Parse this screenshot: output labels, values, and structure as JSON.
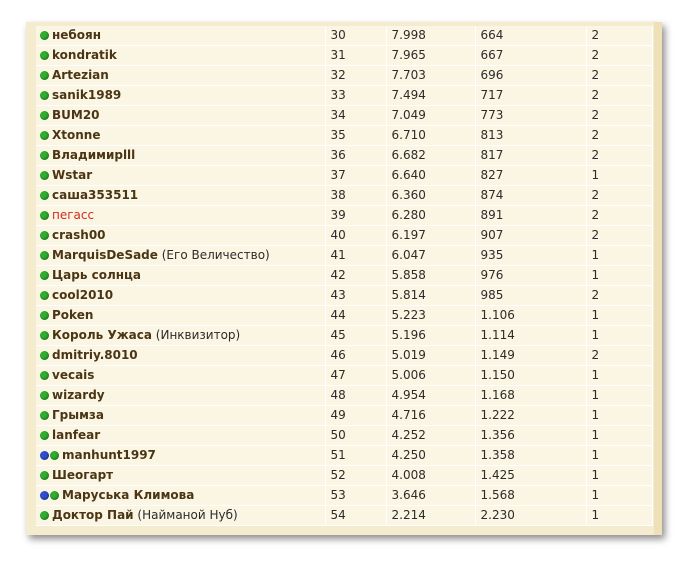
{
  "rows": [
    {
      "dots": [
        "green"
      ],
      "name": "небоян",
      "title": "",
      "red": false,
      "place": "30",
      "score": "7.998",
      "count": "664",
      "level": "2"
    },
    {
      "dots": [
        "green"
      ],
      "name": "kondratik",
      "title": "",
      "red": false,
      "place": "31",
      "score": "7.965",
      "count": "667",
      "level": "2"
    },
    {
      "dots": [
        "green"
      ],
      "name": "Artezian",
      "title": "",
      "red": false,
      "place": "32",
      "score": "7.703",
      "count": "696",
      "level": "2"
    },
    {
      "dots": [
        "green"
      ],
      "name": "sanik1989",
      "title": "",
      "red": false,
      "place": "33",
      "score": "7.494",
      "count": "717",
      "level": "2"
    },
    {
      "dots": [
        "green"
      ],
      "name": "BUM20",
      "title": "",
      "red": false,
      "place": "34",
      "score": "7.049",
      "count": "773",
      "level": "2"
    },
    {
      "dots": [
        "green"
      ],
      "name": "Xtonne",
      "title": "",
      "red": false,
      "place": "35",
      "score": "6.710",
      "count": "813",
      "level": "2"
    },
    {
      "dots": [
        "green"
      ],
      "name": "Владимирlll",
      "title": "",
      "red": false,
      "place": "36",
      "score": "6.682",
      "count": "817",
      "level": "2"
    },
    {
      "dots": [
        "green"
      ],
      "name": "Wstar",
      "title": "",
      "red": false,
      "place": "37",
      "score": "6.640",
      "count": "827",
      "level": "1"
    },
    {
      "dots": [
        "green"
      ],
      "name": "саша353511",
      "title": "",
      "red": false,
      "place": "38",
      "score": "6.360",
      "count": "874",
      "level": "2"
    },
    {
      "dots": [
        "green"
      ],
      "name": "пегасс",
      "title": "",
      "red": true,
      "place": "39",
      "score": "6.280",
      "count": "891",
      "level": "2"
    },
    {
      "dots": [
        "green"
      ],
      "name": "crash00",
      "title": "",
      "red": false,
      "place": "40",
      "score": "6.197",
      "count": "907",
      "level": "2"
    },
    {
      "dots": [
        "green"
      ],
      "name": "MarquisDeSade",
      "title": "(Его Величество)",
      "red": false,
      "place": "41",
      "score": "6.047",
      "count": "935",
      "level": "1"
    },
    {
      "dots": [
        "green"
      ],
      "name": "Царь солнца",
      "title": "",
      "red": false,
      "place": "42",
      "score": "5.858",
      "count": "976",
      "level": "1"
    },
    {
      "dots": [
        "green"
      ],
      "name": "cool2010",
      "title": "",
      "red": false,
      "place": "43",
      "score": "5.814",
      "count": "985",
      "level": "2"
    },
    {
      "dots": [
        "green"
      ],
      "name": "Poken",
      "title": "",
      "red": false,
      "place": "44",
      "score": "5.223",
      "count": "1.106",
      "level": "1"
    },
    {
      "dots": [
        "green"
      ],
      "name": "Король Ужаса",
      "title": "(Инквизитор)",
      "red": false,
      "place": "45",
      "score": "5.196",
      "count": "1.114",
      "level": "1"
    },
    {
      "dots": [
        "green"
      ],
      "name": "dmitriy.8010",
      "title": "",
      "red": false,
      "place": "46",
      "score": "5.019",
      "count": "1.149",
      "level": "2"
    },
    {
      "dots": [
        "green"
      ],
      "name": "vecais",
      "title": "",
      "red": false,
      "place": "47",
      "score": "5.006",
      "count": "1.150",
      "level": "1"
    },
    {
      "dots": [
        "green"
      ],
      "name": "wizardy",
      "title": "",
      "red": false,
      "place": "48",
      "score": "4.954",
      "count": "1.168",
      "level": "1"
    },
    {
      "dots": [
        "green"
      ],
      "name": "Грымза",
      "title": "",
      "red": false,
      "place": "49",
      "score": "4.716",
      "count": "1.222",
      "level": "1"
    },
    {
      "dots": [
        "green"
      ],
      "name": "lanfear",
      "title": "",
      "red": false,
      "place": "50",
      "score": "4.252",
      "count": "1.356",
      "level": "1"
    },
    {
      "dots": [
        "blue",
        "green"
      ],
      "name": "manhunt1997",
      "title": "",
      "red": false,
      "place": "51",
      "score": "4.250",
      "count": "1.358",
      "level": "1"
    },
    {
      "dots": [
        "green"
      ],
      "name": "Шеогарт",
      "title": "",
      "red": false,
      "place": "52",
      "score": "4.008",
      "count": "1.425",
      "level": "1"
    },
    {
      "dots": [
        "blue",
        "green"
      ],
      "name": "Маруська Климова",
      "title": "",
      "red": false,
      "place": "53",
      "score": "3.646",
      "count": "1.568",
      "level": "1"
    },
    {
      "dots": [
        "green"
      ],
      "name": "Доктор Пай",
      "title": "(Найманой Нуб)",
      "red": false,
      "place": "54",
      "score": "2.214",
      "count": "2.230",
      "level": "1"
    }
  ],
  "colors": {
    "frame_bg": "#f5ecd0",
    "cell_bg": "#fbf6e3",
    "nick": "#4a3514",
    "nick_red": "#d22a1f",
    "online_green": "#2fae2f",
    "online_blue": "#2f4fd0"
  }
}
